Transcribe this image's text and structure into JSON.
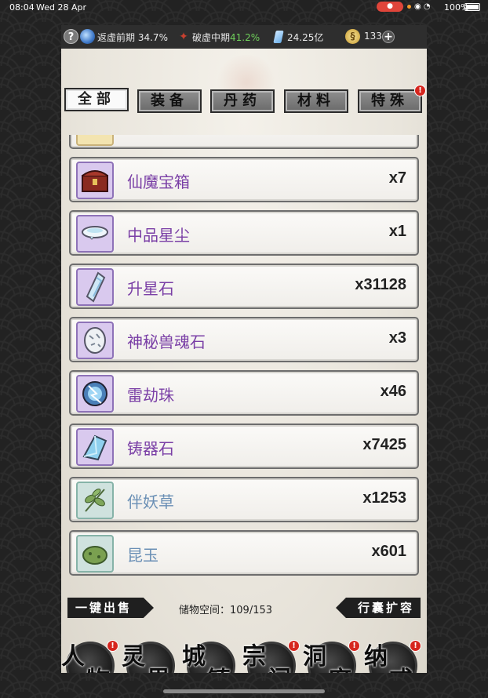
{
  "status_bar": {
    "time": "08:04",
    "date": "Wed 28 Apr",
    "battery": "100%"
  },
  "top_bar": {
    "help": "?",
    "realm1": {
      "name": "返虚前期",
      "pct": "34.7%"
    },
    "realm2": {
      "name": "破虚中期",
      "pct": "41.2%"
    },
    "spirit_stones": "24.25亿",
    "coins": "133",
    "add": "+"
  },
  "tabs": [
    {
      "label": "全部",
      "active": true
    },
    {
      "label": "装备",
      "active": false
    },
    {
      "label": "丹药",
      "active": false
    },
    {
      "label": "材料",
      "active": false
    },
    {
      "label": "特殊",
      "active": false,
      "badge": "!"
    }
  ],
  "items": [
    {
      "name": "仙魔宝箱",
      "qty": "x7",
      "color": "purple",
      "icon": "treasure-chest-icon"
    },
    {
      "name": "中品星尘",
      "qty": "x1",
      "color": "purple",
      "icon": "star-dust-icon"
    },
    {
      "name": "升星石",
      "qty": "x31128",
      "color": "purple",
      "icon": "star-stone-icon"
    },
    {
      "name": "神秘兽魂石",
      "qty": "x3",
      "color": "purple",
      "icon": "beast-soul-stone-icon"
    },
    {
      "name": "雷劫珠",
      "qty": "x46",
      "color": "purple",
      "icon": "thunder-orb-icon"
    },
    {
      "name": "铸器石",
      "qty": "x7425",
      "color": "purple",
      "icon": "forge-crystal-icon"
    },
    {
      "name": "伴妖草",
      "qty": "x1253",
      "color": "blue",
      "icon": "herb-icon"
    },
    {
      "name": "昆玉",
      "qty": "x601",
      "color": "blue",
      "icon": "jade-icon"
    }
  ],
  "bottom": {
    "sell_all": "一键出售",
    "storage_label": "储物空间：",
    "storage_value": "109/153",
    "expand": "行囊扩容"
  },
  "nav": [
    {
      "c1": "人",
      "c2": "物",
      "badge": "!"
    },
    {
      "c1": "灵",
      "c2": "界",
      "badge": ""
    },
    {
      "c1": "城",
      "c2": "镇",
      "badge": ""
    },
    {
      "c1": "宗",
      "c2": "门",
      "badge": "!"
    },
    {
      "c1": "洞",
      "c2": "府",
      "badge": "!"
    },
    {
      "c1": "纳",
      "c2": "戒",
      "badge": "!"
    }
  ],
  "colors": {
    "purple_name": "#7a3fa6",
    "blue_name": "#6a8fb5",
    "badge_red": "#d6261e",
    "progress_green": "#6fcf5a"
  }
}
